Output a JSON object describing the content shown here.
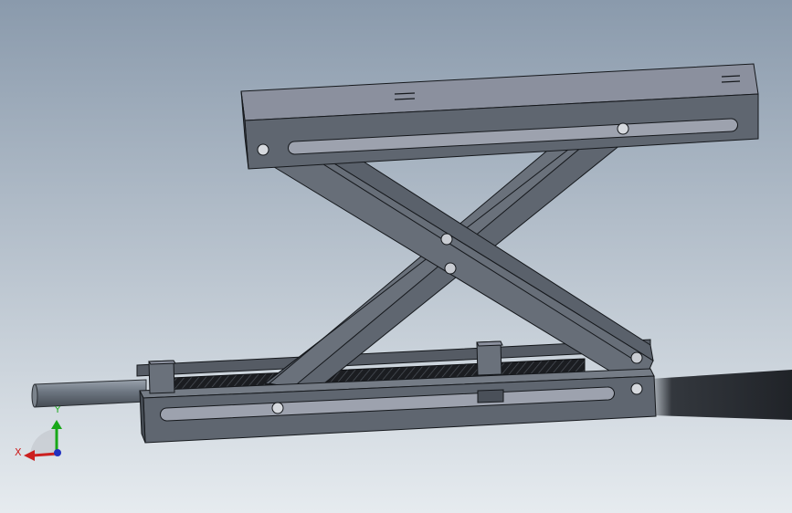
{
  "viewport": {
    "background_top": "#8a9aac",
    "background_bottom": "#e6ebef"
  },
  "model": {
    "part_color": "#5f6670",
    "part_light": "#8b909e",
    "part_dark": "#3c4149",
    "edge_color": "#15181c",
    "screw_color": "#1c1e22",
    "shaft_color": "#6c7580"
  },
  "triad": {
    "x_label": "X",
    "y_label": "Y",
    "x_color": "#cc2020",
    "y_color": "#18a818",
    "z_color": "#2030c0"
  }
}
